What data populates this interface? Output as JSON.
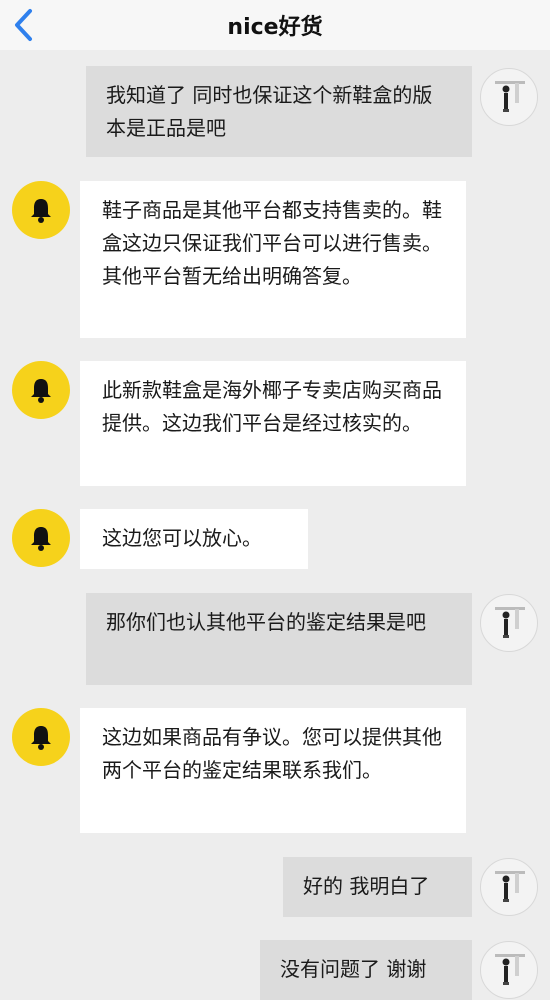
{
  "header": {
    "title": "nice好货"
  },
  "messages": [
    {
      "from": "me",
      "text": "我知道了 同时也保证这个新鞋盒的版本是正品是吧"
    },
    {
      "from": "them",
      "text": "鞋子商品是其他平台都支持售卖的。鞋盒这边只保证我们平台可以进行售卖。其他平台暂无给出明确答复。"
    },
    {
      "from": "them",
      "text": "此新款鞋盒是海外椰子专卖店购买商品提供。这边我们平台是经过核实的。"
    },
    {
      "from": "them",
      "text": "这边您可以放心。"
    },
    {
      "from": "me",
      "text": "那你们也认其他平台的鉴定结果是吧"
    },
    {
      "from": "them",
      "text": "这边如果商品有争议。您可以提供其他两个平台的鉴定结果联系我们。"
    },
    {
      "from": "me",
      "text": "好的 我明白了"
    },
    {
      "from": "me",
      "text": "没有问题了 谢谢"
    }
  ],
  "icons": {
    "back": "chevron-left-icon",
    "them_avatar": "bell-icon",
    "me_avatar": "user-avatar"
  },
  "colors": {
    "accent": "#2f80ed",
    "bell_bg": "#f6d21b",
    "my_bubble": "#dcdcdc",
    "their_bubble": "#ffffff",
    "background": "#ededed"
  }
}
